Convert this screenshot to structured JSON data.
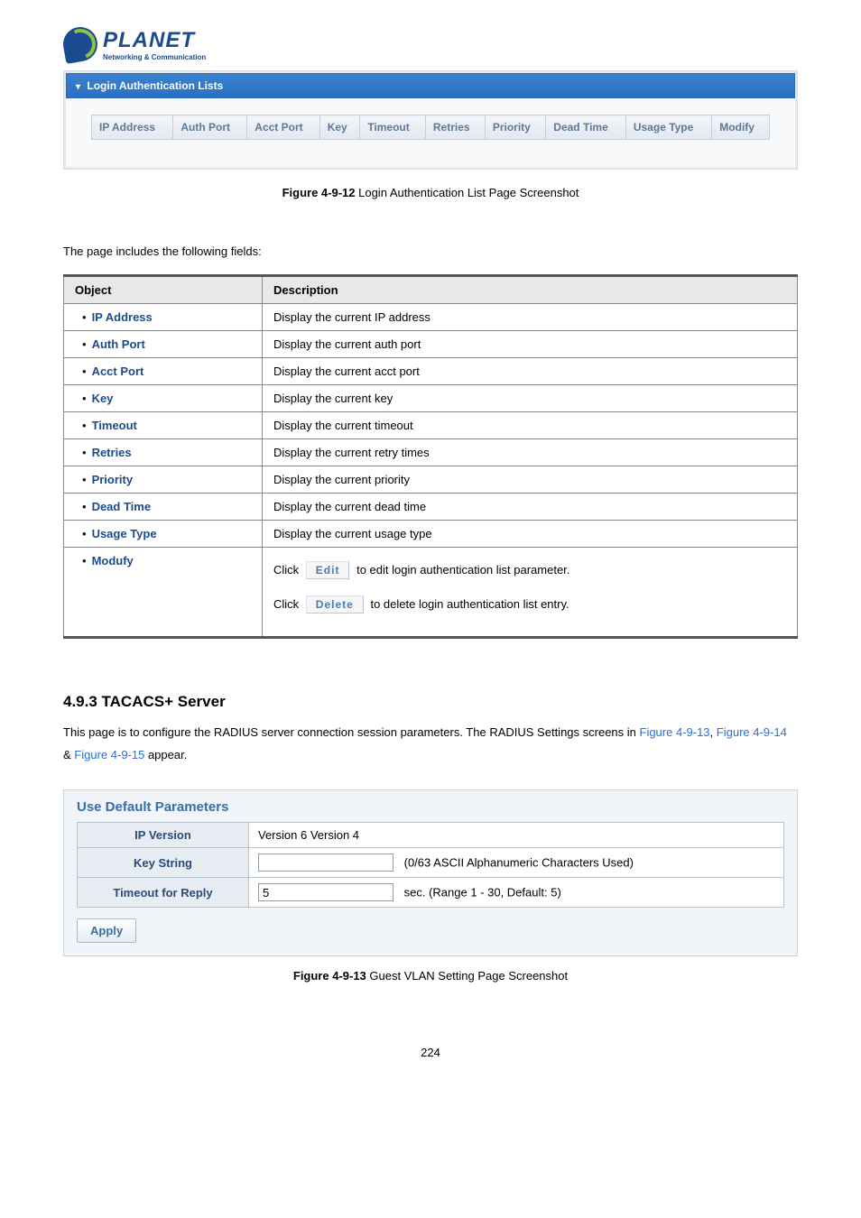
{
  "logo": {
    "name": "PLANET",
    "sub": "Networking & Communication"
  },
  "panel1": {
    "title": "Login Authentication Lists",
    "headers": [
      "IP Address",
      "Auth Port",
      "Acct Port",
      "Key",
      "Timeout",
      "Retries",
      "Priority",
      "Dead Time",
      "Usage Type",
      "Modify"
    ]
  },
  "caption1": {
    "fig": "Figure 4-9-12",
    "text": " Login Authentication List Page Screenshot"
  },
  "intro": "The page includes the following fields:",
  "desc": {
    "head": {
      "obj": "Object",
      "desc": "Description"
    },
    "rows": [
      {
        "obj": "IP Address",
        "desc": "Display the current IP address"
      },
      {
        "obj": "Auth Port",
        "desc": "Display the current auth port"
      },
      {
        "obj": "Acct Port",
        "desc": "Display the current acct port"
      },
      {
        "obj": "Key",
        "desc": "Display the current key"
      },
      {
        "obj": "Timeout",
        "desc": "Display the current timeout"
      },
      {
        "obj": "Retries",
        "desc": "Display the current retry times"
      },
      {
        "obj": "Priority",
        "desc": "Display the current priority"
      },
      {
        "obj": "Dead Time",
        "desc": "Display the current dead time"
      },
      {
        "obj": "Usage Type",
        "desc": "Display the current usage type"
      }
    ],
    "modify": {
      "obj": "Modufy",
      "line1_pre": "Click",
      "edit_btn": "Edit",
      "line1_post": " to edit login authentication list parameter.",
      "line2_pre": "Click",
      "delete_btn": "Delete",
      "line2_post": " to delete login authentication list entry."
    }
  },
  "section": "4.9.3 TACACS+ Server",
  "para": {
    "text1": "This page is to configure the RADIUS server connection session parameters. The RADIUS Settings screens in ",
    "link1": "Figure 4-9-13",
    "sep1": ", ",
    "link2": "Figure 4-9-14",
    "amp": " & ",
    "link3": "Figure 4-9-15",
    "text2": " appear."
  },
  "params": {
    "title": "Use Default Parameters",
    "rows": {
      "ipver": {
        "label": "IP Version",
        "val": "Version 6 Version 4"
      },
      "key": {
        "label": "Key String",
        "hint": "(0/63 ASCII Alphanumeric Characters Used)"
      },
      "timeout": {
        "label": "Timeout for Reply",
        "val": "5",
        "hint": "sec. (Range 1 - 30, Default: 5)"
      }
    },
    "apply": "Apply"
  },
  "caption2": {
    "fig": "Figure 4-9-13",
    "text": " Guest VLAN Setting Page Screenshot"
  },
  "page": "224"
}
